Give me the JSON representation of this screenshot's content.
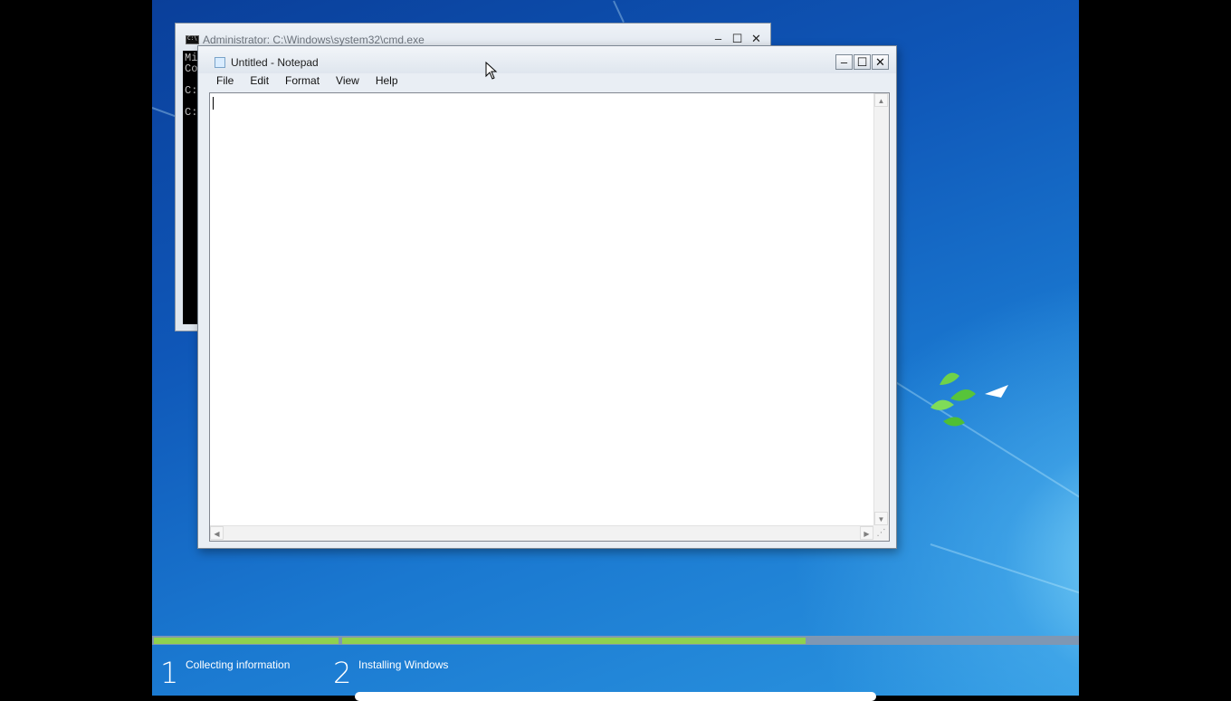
{
  "cmd_window": {
    "title": "Administrator: C:\\Windows\\system32\\cmd.exe",
    "lines": [
      "Mic",
      "Cop",
      "C:\\",
      "C:\\"
    ],
    "buttons": {
      "minimize": "–",
      "maximize": "☐",
      "close": "✕"
    }
  },
  "notepad": {
    "title": "Untitled - Notepad",
    "menu": [
      "File",
      "Edit",
      "Format",
      "View",
      "Help"
    ],
    "content": "",
    "buttons": {
      "minimize": "–",
      "maximize": "☐",
      "close": "✕"
    }
  },
  "setup": {
    "steps": [
      {
        "number": "1",
        "label": "Collecting information"
      },
      {
        "number": "2",
        "label": "Installing Windows"
      }
    ],
    "progress": {
      "step1_complete": 1.0,
      "step2_fraction": 0.63
    },
    "colors": {
      "progress_fill": "#8fd14f",
      "progress_track": "#7f97b3"
    }
  }
}
